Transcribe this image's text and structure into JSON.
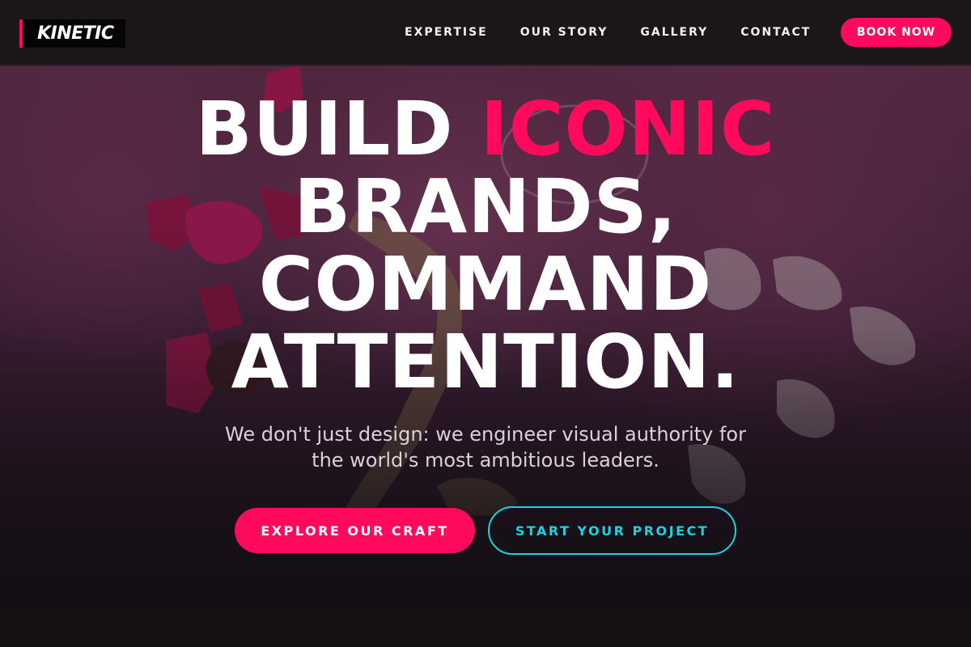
{
  "brand": {
    "logo_text": "KINETIC",
    "accent_color": "#ff0a5c",
    "secondary_color": "#19d3df"
  },
  "nav": {
    "links": [
      "EXPERTISE",
      "OUR STORY",
      "GALLERY",
      "CONTACT"
    ],
    "book_label": "BOOK NOW"
  },
  "hero": {
    "headline_line1_part1": "BUILD ",
    "headline_line1_accent": "ICONIC",
    "headline_line2": "BRANDS,",
    "headline_line3": "COMMAND",
    "headline_line4": "ATTENTION.",
    "subtitle": "We don't just design: we engineer visual authority for the world's most ambitious leaders.",
    "cta_primary": "EXPLORE OUR CRAFT",
    "cta_secondary": "START YOUR PROJECT",
    "background_image": "pink-fur-candy-flatlay"
  }
}
